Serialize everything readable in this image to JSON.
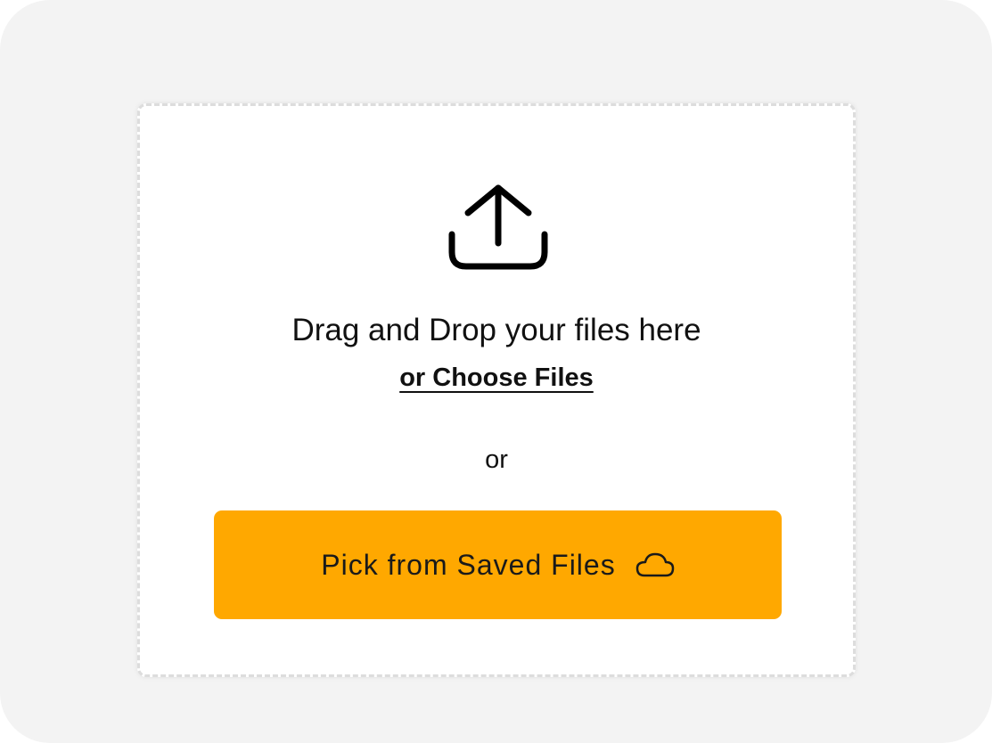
{
  "upload_area": {
    "drag_text": "Drag and Drop your files here",
    "choose_link": "or Choose Files",
    "separator": "or",
    "saved_files_button": "Pick from Saved Files",
    "upload_icon": "upload-icon",
    "cloud_icon": "cloud-icon"
  },
  "colors": {
    "background": "#f3f3f3",
    "accent": "#ffa800",
    "text": "#111111"
  }
}
